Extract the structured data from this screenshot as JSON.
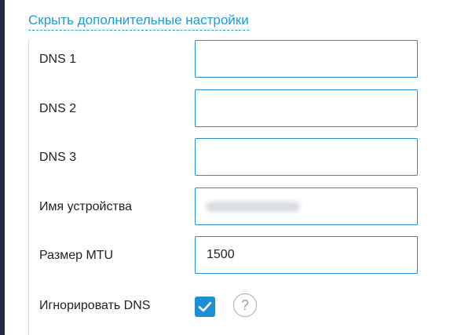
{
  "settings": {
    "toggle_label": "Скрыть дополнительные настройки",
    "rows": [
      {
        "label": "DNS 1",
        "value": ""
      },
      {
        "label": "DNS 2",
        "value": ""
      },
      {
        "label": "DNS 3",
        "value": ""
      },
      {
        "label": "Имя устройства",
        "value": ""
      },
      {
        "label": "Размер MTU",
        "value": "1500"
      },
      {
        "label": "Игнорировать DNS",
        "checked": true
      }
    ],
    "help_symbol": "?"
  },
  "colors": {
    "accent": "#1d9bd6",
    "input_border": "#2a8bd4",
    "checkbox_bg": "#1d8fd9",
    "sidebar": "#1c2a47"
  },
  "icons": {
    "checkbox": "checkmark-icon",
    "help": "question-circle-icon"
  }
}
